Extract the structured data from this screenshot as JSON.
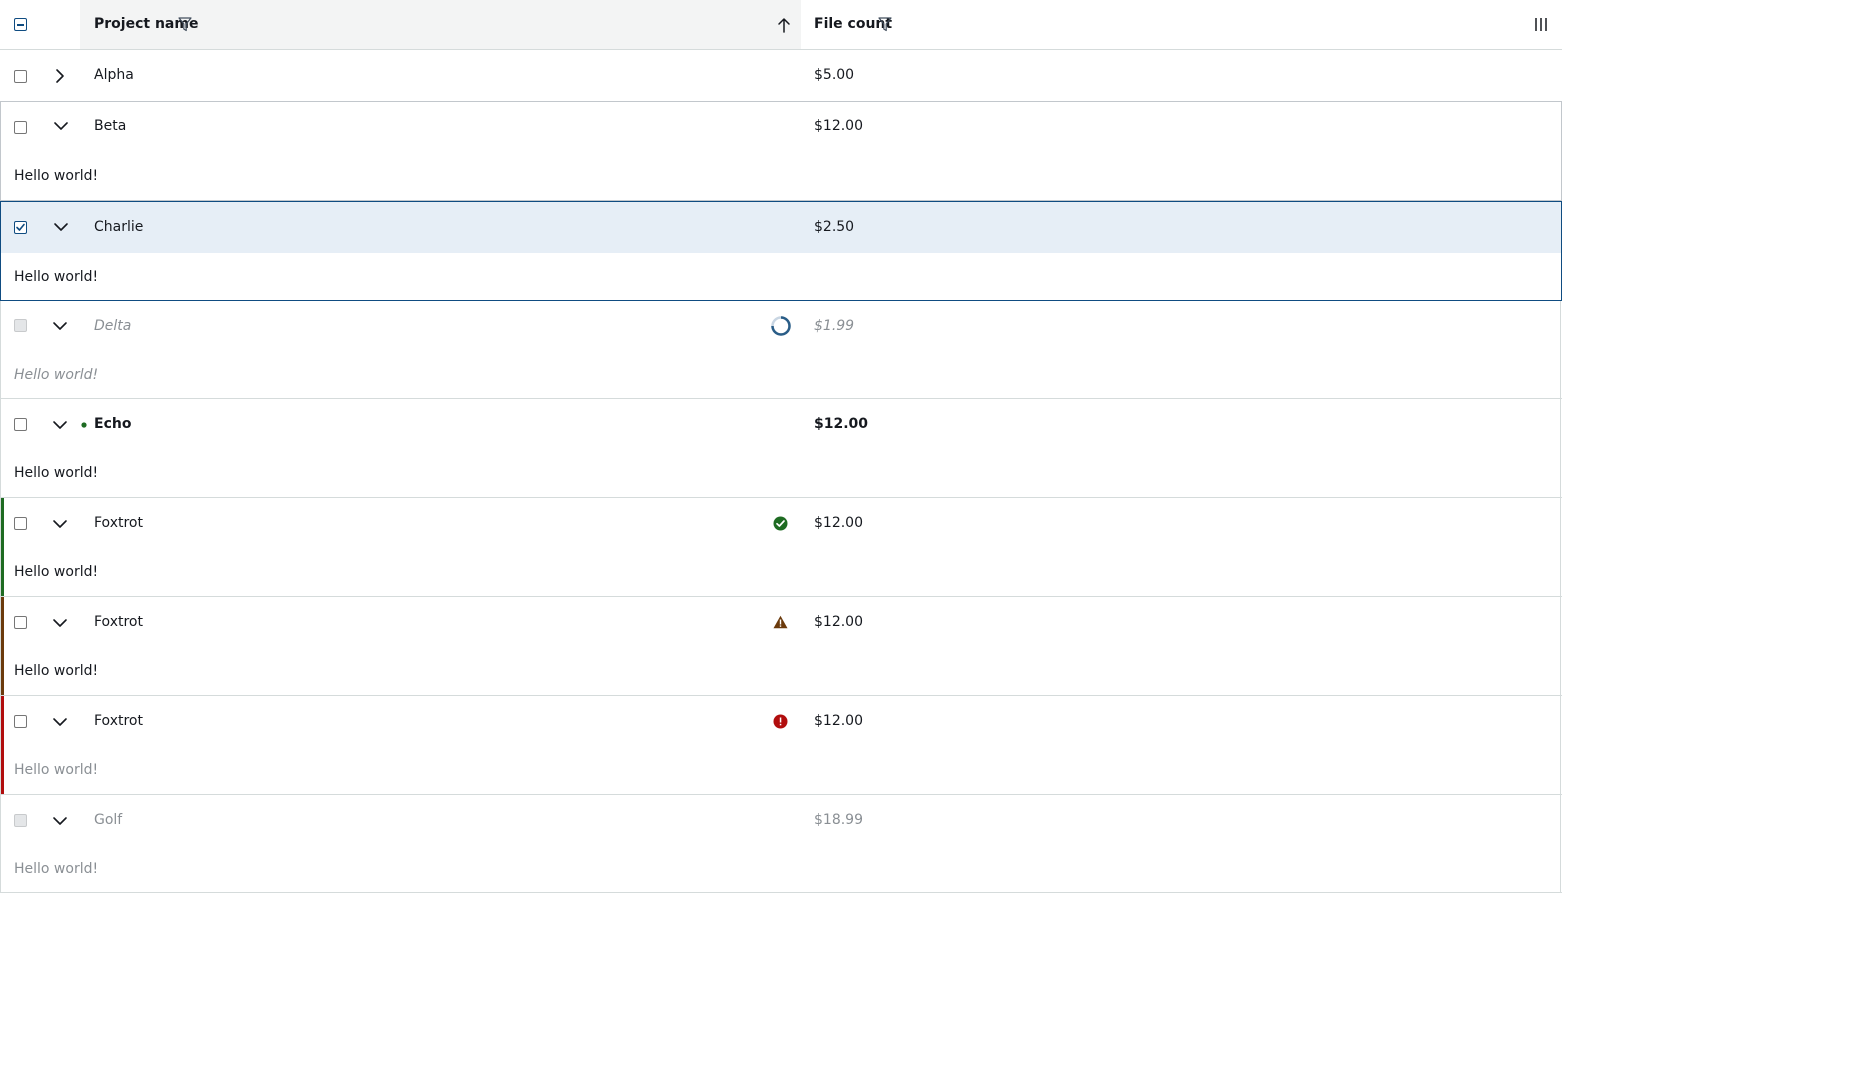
{
  "header": {
    "project_name_label": "Project name",
    "file_count_label": "File count"
  },
  "colors": {
    "accent_blue": "#0f4c81",
    "selected_row_bg": "#e6eef6",
    "success": "#1e6b22",
    "warning": "#6b3a0c",
    "error": "#b10d0d",
    "status_dot": "#1e6b22"
  },
  "rows": [
    {
      "name": "Alpha",
      "file_count": "$5.00",
      "expanded": false,
      "selected": false,
      "state": "normal"
    },
    {
      "name": "Beta",
      "file_count": "$12.00",
      "expanded": true,
      "selected": false,
      "state": "normal",
      "detail": "Hello world!"
    },
    {
      "name": "Charlie",
      "file_count": "$2.50",
      "expanded": true,
      "selected": true,
      "state": "selected",
      "detail": "Hello world!"
    },
    {
      "name": "Delta",
      "file_count": "$1.99",
      "expanded": true,
      "selected": false,
      "state": "loading",
      "status_icon": "spinner-icon",
      "detail": "Hello world!"
    },
    {
      "name": "Echo",
      "file_count": "$12.00",
      "expanded": true,
      "selected": false,
      "state": "unread",
      "status_icon": "dot-icon",
      "detail": "Hello world!"
    },
    {
      "name": "Foxtrot",
      "file_count": "$12.00",
      "expanded": true,
      "selected": false,
      "state": "success",
      "status_icon": "check-circle-icon",
      "detail": "Hello world!"
    },
    {
      "name": "Foxtrot",
      "file_count": "$12.00",
      "expanded": true,
      "selected": false,
      "state": "warning",
      "status_icon": "warning-triangle-icon",
      "detail": "Hello world!"
    },
    {
      "name": "Foxtrot",
      "file_count": "$12.00",
      "expanded": true,
      "selected": false,
      "state": "error",
      "status_icon": "error-circle-icon",
      "detail": "Hello world!"
    },
    {
      "name": "Golf",
      "file_count": "$18.99",
      "expanded": true,
      "selected": false,
      "state": "disabled",
      "detail": "Hello world!"
    }
  ]
}
